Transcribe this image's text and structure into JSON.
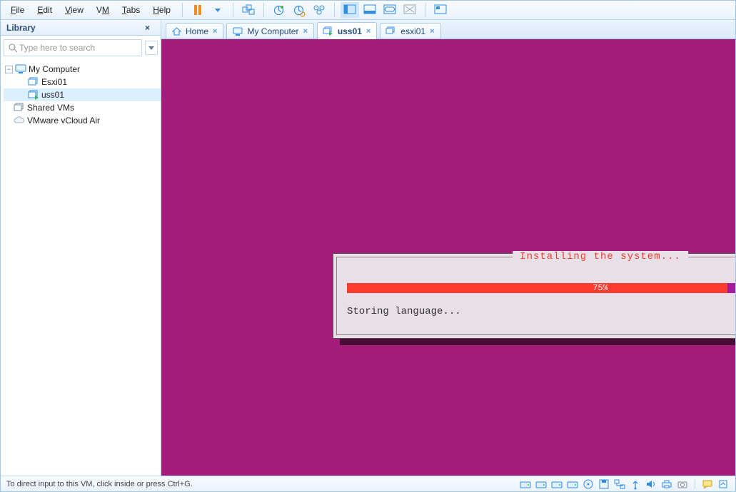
{
  "menu": {
    "file": "File",
    "edit": "Edit",
    "view": "View",
    "vm": "VM",
    "tabs": "Tabs",
    "help": "Help"
  },
  "sidebar": {
    "title": "Library",
    "search_placeholder": "Type here to search",
    "tree": {
      "my_computer": "My Computer",
      "esxi01": "Esxi01",
      "uss01": "uss01",
      "shared_vms": "Shared VMs",
      "vcloud": "VMware vCloud Air"
    }
  },
  "tabs": {
    "home": "Home",
    "my_computer": "My Computer",
    "uss01": "uss01",
    "esxi01": "esxi01"
  },
  "installer": {
    "title": "Installing the system...",
    "progress_pct": 75,
    "progress_label": "75%",
    "status": "Storing language..."
  },
  "statusbar": {
    "hint": "To direct input to this VM, click inside or press Ctrl+G."
  },
  "colors": {
    "vm_bg": "#a31c7a",
    "progress_fill": "#ff3b2d",
    "progress_track": "#a31c9b",
    "accent_blue": "#2f8de4"
  }
}
